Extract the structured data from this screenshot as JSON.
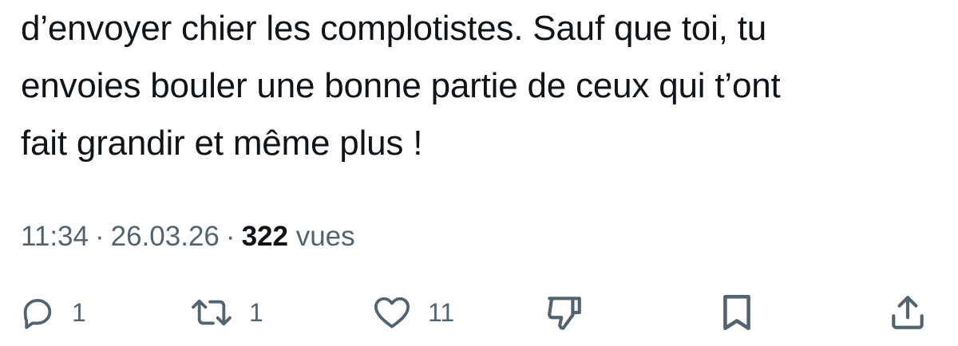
{
  "tweet": {
    "lines": [
      "d’envoyer chier les complotistes. Sauf que toi, tu",
      "envoies bouler une bonne partie de ceux qui t’ont",
      "fait grandir et même plus !"
    ],
    "time": "11:34",
    "separator": "·",
    "date": "26.03.26",
    "views_count": "322",
    "views_label": "vues"
  },
  "actions": {
    "reply": {
      "icon": "reply-icon",
      "count": "1"
    },
    "retweet": {
      "icon": "retweet-icon",
      "count": "1"
    },
    "like": {
      "icon": "heart-icon",
      "count": "11"
    },
    "dislike": {
      "icon": "thumbs-down-icon"
    },
    "bookmark": {
      "icon": "bookmark-icon"
    },
    "share": {
      "icon": "share-icon"
    }
  },
  "colors": {
    "text": "#0f1419",
    "muted": "#536471",
    "background": "#ffffff"
  }
}
